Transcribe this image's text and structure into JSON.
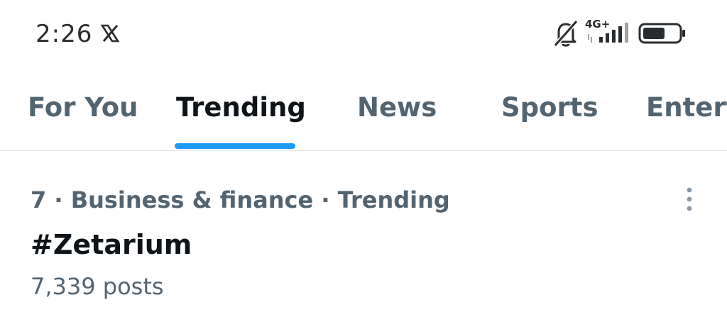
{
  "status_bar": {
    "time": "2:26",
    "network": "4G+",
    "icons": [
      "x-logo-icon",
      "bell-muted-icon",
      "signal-strength-icon",
      "battery-icon"
    ]
  },
  "tabs": [
    {
      "label": "For You",
      "active": false
    },
    {
      "label": "Trending",
      "active": true
    },
    {
      "label": "News",
      "active": false
    },
    {
      "label": "Sports",
      "active": false
    },
    {
      "label": "Entert",
      "active": false
    }
  ],
  "trend": {
    "meta": "7 · Business & finance · Trending",
    "name": "#Zetarium",
    "count": "7,339 posts"
  },
  "colors": {
    "accent": "#1d9bf0",
    "text_primary": "#0f1419",
    "text_secondary": "#536471"
  }
}
